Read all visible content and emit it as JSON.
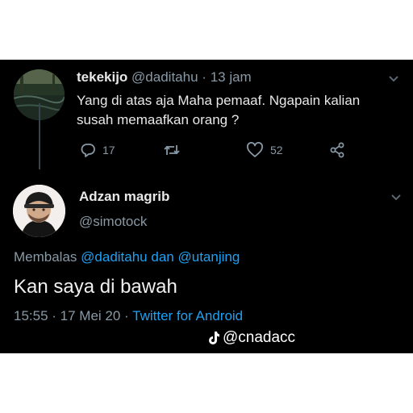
{
  "colors": {
    "background": "#000000",
    "text": "#e8e8e8",
    "muted": "#8899a6",
    "link": "#1da1f2"
  },
  "parent_tweet": {
    "name": "tekekijo",
    "handle": "@daditahu",
    "separator": "·",
    "time": "13 jam",
    "text": "Yang di atas aja Maha pemaaf.  Ngapain kalian susah memaafkan orang ?",
    "replies": "17",
    "likes": "52",
    "icons": [
      "reply-icon",
      "retweet-icon",
      "like-icon",
      "share-icon",
      "chevron-down-icon"
    ]
  },
  "reply_tweet": {
    "name": "Adzan magrib",
    "handle": "@simotock",
    "replying_prefix": "Membalas",
    "replying_to_1": "@daditahu",
    "replying_joiner": "dan",
    "replying_to_2": "@utanjing",
    "text": "Kan saya di bawah",
    "timestamp": "15:55 · 17 Mei 20 ·",
    "source": "Twitter for Android"
  },
  "watermark": {
    "icon": "tiktok-icon",
    "text": "@cnadacc"
  }
}
